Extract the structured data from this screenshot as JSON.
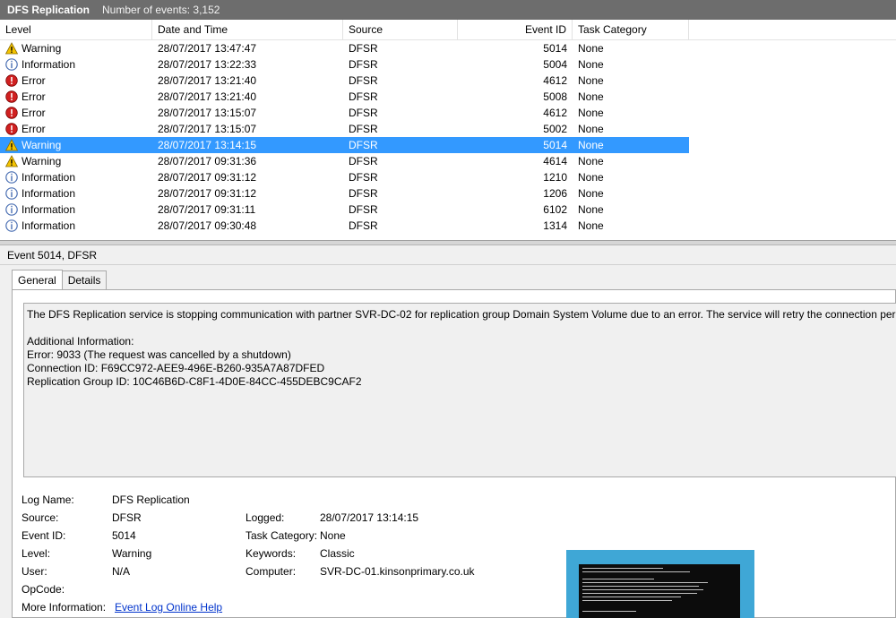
{
  "window": {
    "title": "DFS Replication",
    "count_text": "Number of events: 3,152"
  },
  "columns": [
    "Level",
    "Date and Time",
    "Source",
    "Event ID",
    "Task Category"
  ],
  "events": [
    {
      "level": "Warning",
      "icon": "warning-icon",
      "datetime": "28/07/2017 13:47:47",
      "source": "DFSR",
      "event_id": "5014",
      "category": "None"
    },
    {
      "level": "Information",
      "icon": "information-icon",
      "datetime": "28/07/2017 13:22:33",
      "source": "DFSR",
      "event_id": "5004",
      "category": "None"
    },
    {
      "level": "Error",
      "icon": "error-icon",
      "datetime": "28/07/2017 13:21:40",
      "source": "DFSR",
      "event_id": "4612",
      "category": "None"
    },
    {
      "level": "Error",
      "icon": "error-icon",
      "datetime": "28/07/2017 13:21:40",
      "source": "DFSR",
      "event_id": "5008",
      "category": "None"
    },
    {
      "level": "Error",
      "icon": "error-icon",
      "datetime": "28/07/2017 13:15:07",
      "source": "DFSR",
      "event_id": "4612",
      "category": "None"
    },
    {
      "level": "Error",
      "icon": "error-icon",
      "datetime": "28/07/2017 13:15:07",
      "source": "DFSR",
      "event_id": "5002",
      "category": "None"
    },
    {
      "level": "Warning",
      "icon": "warning-icon",
      "datetime": "28/07/2017 13:14:15",
      "source": "DFSR",
      "event_id": "5014",
      "category": "None",
      "selected": true
    },
    {
      "level": "Warning",
      "icon": "warning-icon",
      "datetime": "28/07/2017 09:31:36",
      "source": "DFSR",
      "event_id": "4614",
      "category": "None"
    },
    {
      "level": "Information",
      "icon": "information-icon",
      "datetime": "28/07/2017 09:31:12",
      "source": "DFSR",
      "event_id": "1210",
      "category": "None"
    },
    {
      "level": "Information",
      "icon": "information-icon",
      "datetime": "28/07/2017 09:31:12",
      "source": "DFSR",
      "event_id": "1206",
      "category": "None"
    },
    {
      "level": "Information",
      "icon": "information-icon",
      "datetime": "28/07/2017 09:31:11",
      "source": "DFSR",
      "event_id": "6102",
      "category": "None"
    },
    {
      "level": "Information",
      "icon": "information-icon",
      "datetime": "28/07/2017 09:30:48",
      "source": "DFSR",
      "event_id": "1314",
      "category": "None"
    }
  ],
  "detail": {
    "title": "Event 5014, DFSR",
    "tabs": [
      "General",
      "Details"
    ],
    "message_lines": [
      "The DFS Replication service is stopping communication with partner SVR-DC-02 for replication group Domain System Volume due to an error. The service will retry the connection periodically.",
      "",
      "Additional Information:",
      "Error: 9033 (The request was cancelled by a shutdown)",
      "Connection ID: F69CC972-AEE9-496E-B260-935A7A87DFED",
      "Replication Group ID: 10C46B6D-C8F1-4D0E-84CC-455DEBC9CAF2"
    ],
    "props": {
      "log_name_label": "Log Name:",
      "log_name": "DFS Replication",
      "source_label": "Source:",
      "source": "DFSR",
      "logged_label": "Logged:",
      "logged": "28/07/2017 13:14:15",
      "event_id_label": "Event ID:",
      "event_id": "5014",
      "task_category_label": "Task Category:",
      "task_category": "None",
      "level_label": "Level:",
      "level": "Warning",
      "keywords_label": "Keywords:",
      "keywords": "Classic",
      "user_label": "User:",
      "user": "N/A",
      "computer_label": "Computer:",
      "computer": "SVR-DC-01.kinsonprimary.co.uk",
      "opcode_label": "OpCode:",
      "more_info_label": "More Information:",
      "more_info_link": "Event Log Online Help"
    }
  },
  "colors": {
    "selection": "#3399ff",
    "warning": "#f5c400",
    "error": "#d02020",
    "information": "#4a6fb3"
  }
}
